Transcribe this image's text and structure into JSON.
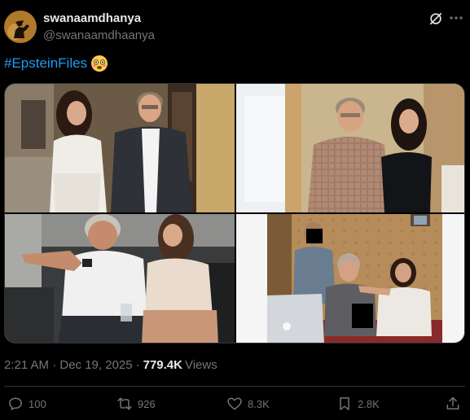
{
  "post": {
    "author": {
      "display_name": "swanaamdhanya",
      "handle": "@swanaamdhaanya"
    },
    "icons": {
      "grok": "grok-icon",
      "more": "more-horizontal-icon"
    },
    "text": "#EpsteinFiles",
    "emoji": "flushed-face",
    "media_count": 4,
    "timestamp": "2:21 AM · Dec 19, 2025",
    "views_count": "779.4K",
    "views_label": "Views",
    "actions": {
      "replies": "100",
      "reposts": "926",
      "likes": "8.3K",
      "bookmarks": "2.8K"
    },
    "colors": {
      "background": "#000000",
      "text": "#e7e9ea",
      "muted": "#71767b",
      "link": "#1d9bf0",
      "border": "#2f3336"
    }
  }
}
